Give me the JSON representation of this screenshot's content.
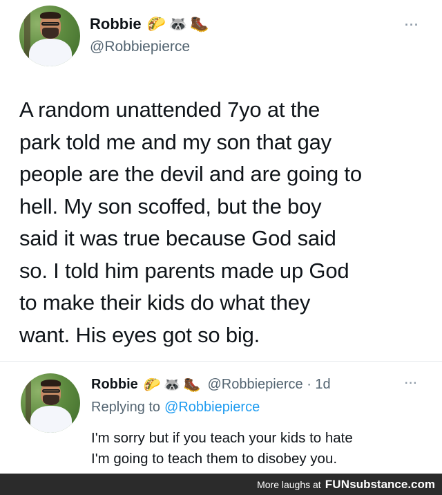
{
  "tweet": {
    "display_name": "Robbie",
    "emojis": [
      "🌮",
      "🦝",
      "🥾"
    ],
    "handle": "@Robbiepierce",
    "more": "···",
    "text_lines": [
      "A random unattended 7yo at the",
      "park told me and my son that gay",
      "people are the devil and are going to",
      "hell. My son scoffed, but the boy",
      "said it was true because God said",
      "so. I told him parents made up God",
      "to make their kids do what they",
      "want. His eyes got so big."
    ]
  },
  "reply": {
    "display_name": "Robbie",
    "emojis": [
      "🌮",
      "🦝",
      "🥾"
    ],
    "handle_time": "@Robbiepierce · 1d",
    "more": "···",
    "replying_prefix": "Replying to",
    "replying_handle": "@Robbiepierce",
    "text_lines": [
      "I'm sorry but if you teach your kids to hate",
      "I'm going to teach them to disobey you."
    ]
  },
  "footer": {
    "prefix": "More laughs at",
    "brand_bold": "FUN",
    "brand_rest": "substance.com"
  },
  "colors": {
    "link": "#1d9bf0",
    "secondary": "#536471",
    "footer_bg": "#2b2b2b"
  }
}
